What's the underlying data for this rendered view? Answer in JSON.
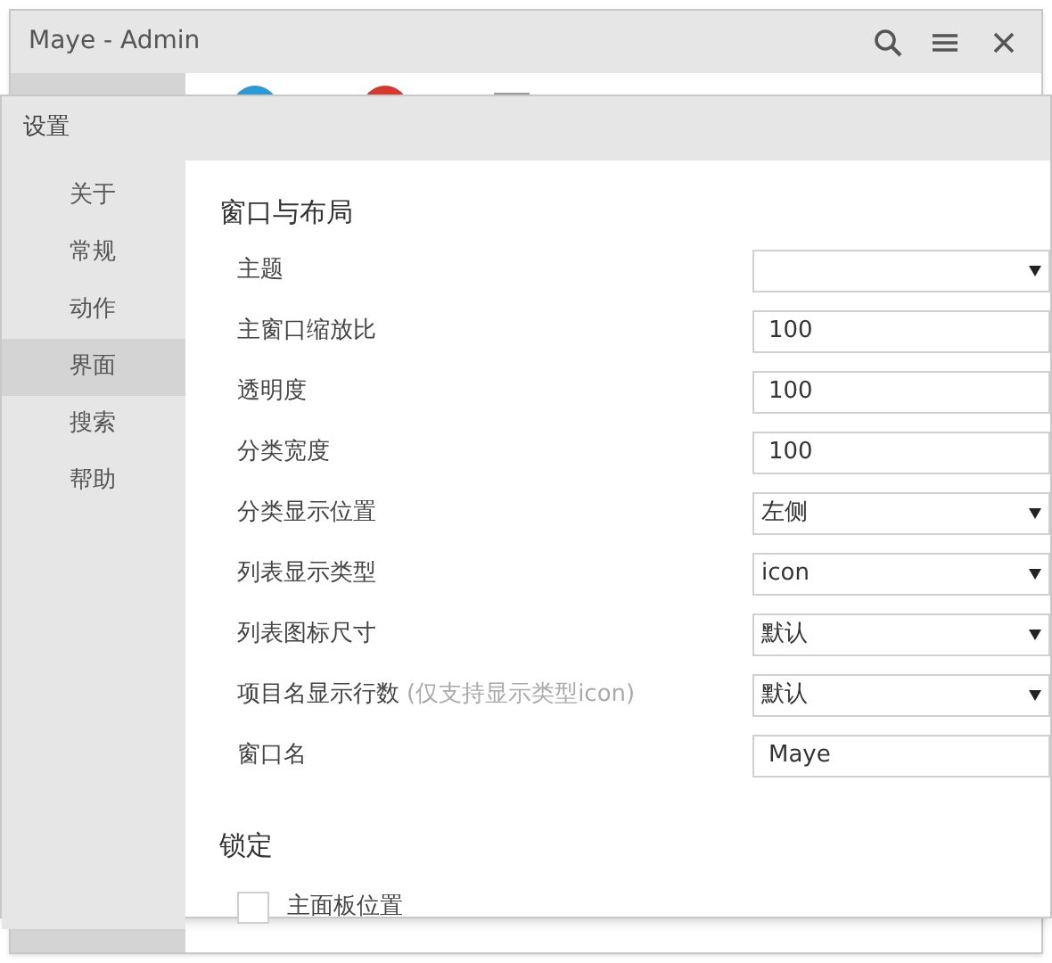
{
  "main_window": {
    "title": "Maye - Admin"
  },
  "settings_window": {
    "title": "设置",
    "sidebar": {
      "items": [
        {
          "label": "关于",
          "selected": false
        },
        {
          "label": "常规",
          "selected": false
        },
        {
          "label": "动作",
          "selected": false
        },
        {
          "label": "界面",
          "selected": true
        },
        {
          "label": "搜索",
          "selected": false
        },
        {
          "label": "帮助",
          "selected": false
        }
      ]
    },
    "sections": [
      {
        "title": "窗口与布局",
        "rows": [
          {
            "kind": "select",
            "label": "主题",
            "value": ""
          },
          {
            "kind": "input",
            "label": "主窗口缩放比",
            "value": "100"
          },
          {
            "kind": "input",
            "label": "透明度",
            "value": "100"
          },
          {
            "kind": "input",
            "label": "分类宽度",
            "value": "100"
          },
          {
            "kind": "select",
            "label": "分类显示位置",
            "value": "左侧"
          },
          {
            "kind": "select",
            "label": "列表显示类型",
            "value": "icon"
          },
          {
            "kind": "select",
            "label": "列表图标尺寸",
            "value": "默认"
          },
          {
            "kind": "select",
            "label": "项目名显示行数",
            "note": "(仅支持显示类型icon)",
            "value": "默认"
          },
          {
            "kind": "input",
            "label": "窗口名",
            "value": "Maye"
          }
        ]
      },
      {
        "title": "锁定",
        "rows": [
          {
            "kind": "checkbox",
            "label": "主面板位置",
            "checked": false
          }
        ]
      }
    ]
  }
}
